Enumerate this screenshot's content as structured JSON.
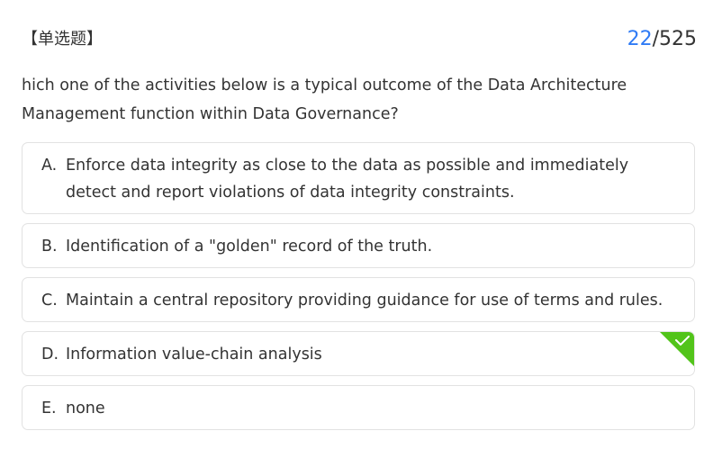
{
  "header": {
    "question_type": "【单选题】",
    "progress_current": "22",
    "progress_total": "/525"
  },
  "question": {
    "text": "hich one of the activities below is a typical outcome of the Data Architecture Management function within Data Governance?"
  },
  "options": [
    {
      "letter": "A.",
      "text": "Enforce data integrity as close to the data as possible and immediately detect and report violations of data integrity constraints."
    },
    {
      "letter": "B.",
      "text": "Identification of a \"golden\" record of the truth."
    },
    {
      "letter": "C.",
      "text": "Maintain a central repository providing guidance for use of terms and rules."
    },
    {
      "letter": "D.",
      "text": "Information value-chain analysis",
      "correct": true
    },
    {
      "letter": "E.",
      "text": "none"
    }
  ],
  "colors": {
    "accent": "#2f7bf5",
    "correct": "#52c41a"
  },
  "icons": {
    "correct_marker": "checkmark-icon"
  }
}
